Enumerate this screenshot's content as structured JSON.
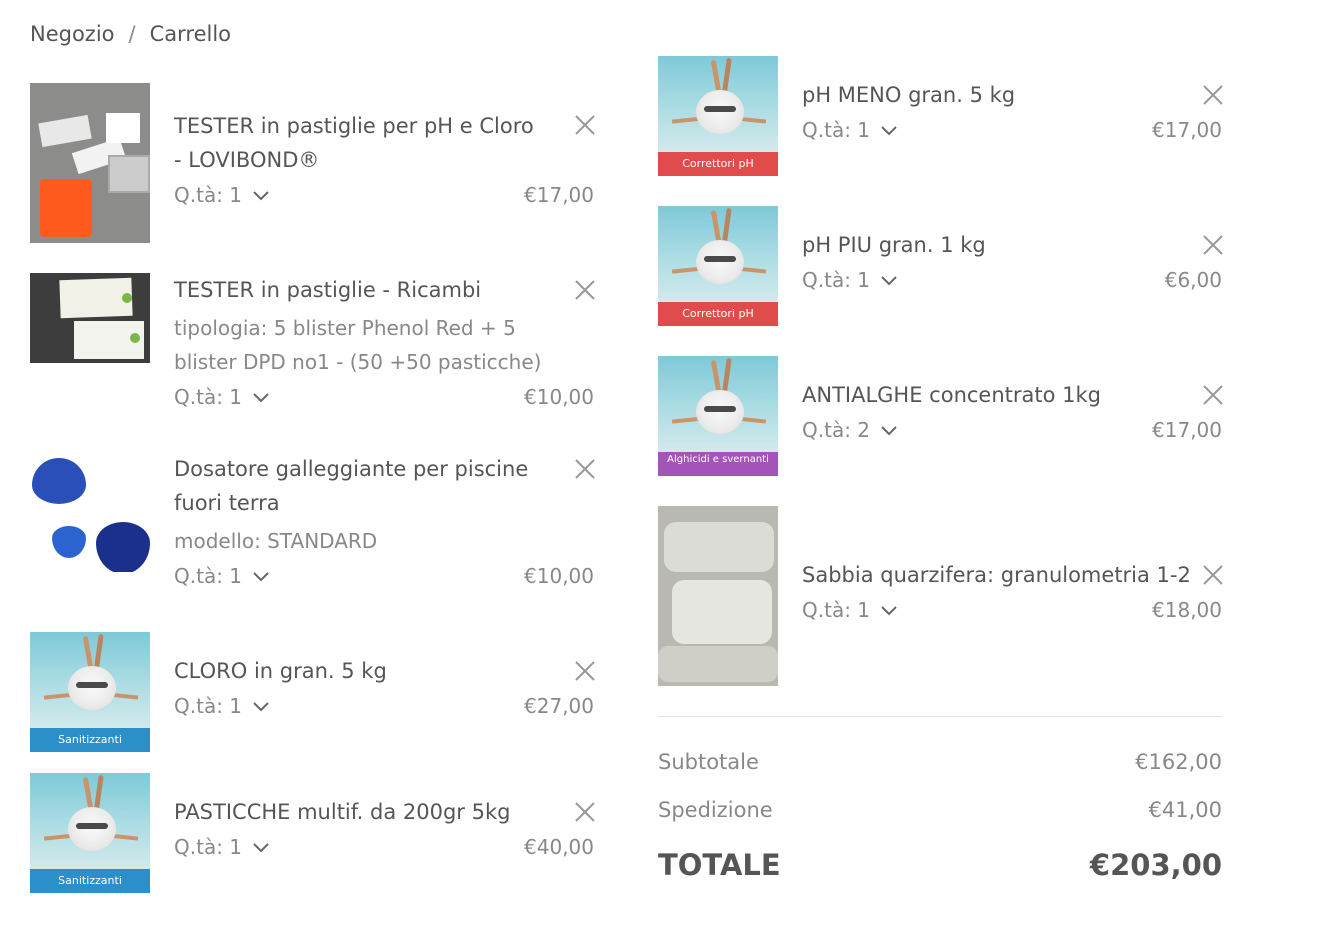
{
  "breadcrumb": {
    "shop": "Negozio",
    "separator": "/",
    "current": "Carrello"
  },
  "qty_prefix": "Q.tà:",
  "items": [
    {
      "name": "TESTER in pastiglie per pH e Cloro - LOVIBOND®",
      "variant": "",
      "qty": "Q.tà: 1",
      "price": "€17,00",
      "thumb": "tester-kit"
    },
    {
      "name": "TESTER in pastiglie - Ricambi",
      "variant": "tipologia: 5 blister Phenol Red + 5 blister DPD no1 - (50 +50 pasticche)",
      "qty": "Q.tà: 1",
      "price": "€10,00",
      "thumb": "tester-refill"
    },
    {
      "name": "Dosatore galleggiante per piscine fuori terra",
      "variant": "modello: STANDARD",
      "qty": "Q.tà: 1",
      "price": "€10,00",
      "thumb": "floating-dispenser"
    },
    {
      "name": "CLORO in gran. 5 kg",
      "variant": "",
      "qty": "Q.tà: 1",
      "price": "€27,00",
      "thumb": "pool-label",
      "label": "Sanitizzanti"
    },
    {
      "name": "PASTICCHE multif. da 200gr 5kg",
      "variant": "",
      "qty": "Q.tà: 1",
      "price": "€40,00",
      "thumb": "pool-label",
      "label": "Sanitizzanti"
    },
    {
      "name": "pH MENO gran. 5 kg",
      "variant": "",
      "qty": "Q.tà: 1",
      "price": "€17,00",
      "thumb": "pool-label",
      "label": "Correttori pH"
    },
    {
      "name": "pH PIU gran. 1 kg",
      "variant": "",
      "qty": "Q.tà: 1",
      "price": "€6,00",
      "thumb": "pool-label",
      "label": "Correttori pH"
    },
    {
      "name": "ANTIALGHE concentrato 1kg",
      "variant": "",
      "qty": "Q.tà: 2",
      "price": "€17,00",
      "thumb": "pool-label",
      "label": "Alghicidi e svernanti"
    },
    {
      "name": "Sabbia quarzifera: granulometria 1-2",
      "variant": "",
      "qty": "Q.tà: 1",
      "price": "€18,00",
      "thumb": "sand-bags"
    }
  ],
  "totals": {
    "subtotal_label": "Subtotale",
    "subtotal_value": "€162,00",
    "shipping_label": "Spedizione",
    "shipping_value": "€41,00",
    "total_label": "TOTALE",
    "total_value": "€203,00"
  },
  "colors": {
    "sanitizzanti": "#2b8fc9",
    "correttori_ph": "#e04b4b",
    "alghicidi": "#a453b8",
    "text": "#555555",
    "muted": "#888888"
  },
  "icons": {
    "remove": "close-icon",
    "qty_toggle": "chevron-down-icon"
  }
}
